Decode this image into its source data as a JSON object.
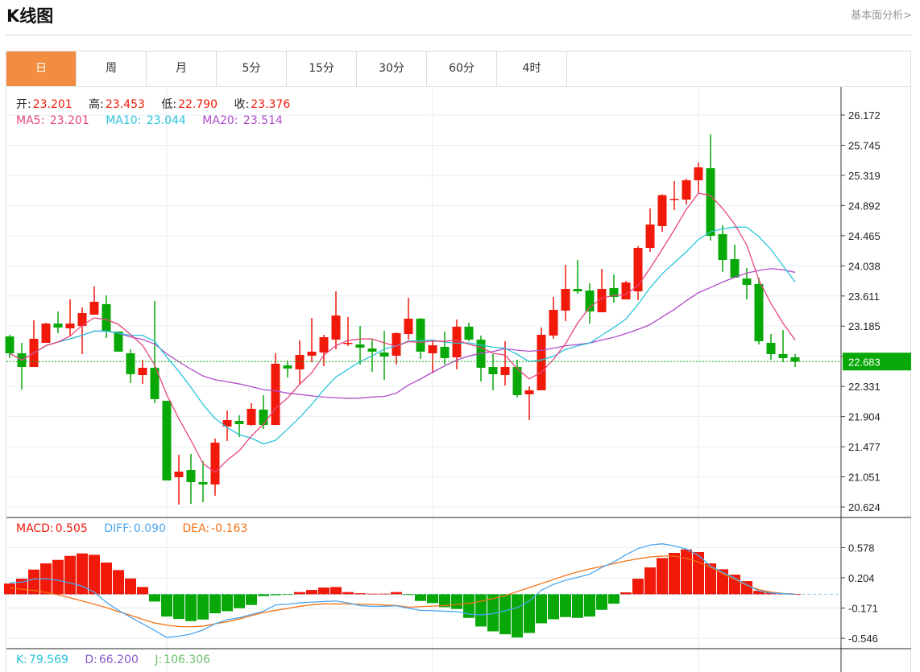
{
  "header": {
    "title": "K线图",
    "link": "基本面分析>"
  },
  "tabs": [
    {
      "label": "日",
      "active": true
    },
    {
      "label": "周"
    },
    {
      "label": "月"
    },
    {
      "label": "5分"
    },
    {
      "label": "15分"
    },
    {
      "label": "30分"
    },
    {
      "label": "60分"
    },
    {
      "label": "4时"
    }
  ],
  "ohlc": {
    "open_label": "开:",
    "open": "23.201",
    "high_label": "高:",
    "high": "23.453",
    "low_label": "低:",
    "low": "22.790",
    "close_label": "收:",
    "close": "23.376"
  },
  "ma": {
    "ma5_label": "MA5:",
    "ma5": "23.201",
    "ma10_label": "MA10:",
    "ma10": "23.044",
    "ma20_label": "MA20:",
    "ma20": "23.514"
  },
  "macd_info": {
    "macd_label": "MACD:",
    "macd": "0.505",
    "diff_label": "DIFF:",
    "diff": "0.090",
    "dea_label": "DEA:",
    "dea": "-0.163"
  },
  "kdj_info": {
    "k_label": "K:",
    "k": "79.569",
    "d_label": "D:",
    "d": "66.200",
    "j_label": "J:",
    "j": "106.306"
  },
  "colors": {
    "up": "#f0190a",
    "down": "#08a808",
    "ma5": "#e8467c",
    "ma10": "#2bc4dc",
    "ma20": "#b04cc8",
    "diff": "#4da6f0",
    "dea": "#f57314",
    "accent": "#f28c40"
  },
  "chart_data": {
    "type": "candlestick",
    "price_ticks": [
      "26.172",
      "25.745",
      "25.319",
      "24.892",
      "24.465",
      "24.038",
      "23.611",
      "23.185",
      "22.758",
      "22.331",
      "21.904",
      "21.477",
      "21.051",
      "20.624"
    ],
    "price_range": [
      20.624,
      26.172
    ],
    "last_price": "22.683",
    "candles_ohlc": [
      [
        23.039,
        23.062,
        22.732,
        22.8
      ],
      [
        22.8,
        22.948,
        22.287,
        22.606
      ],
      [
        22.606,
        23.267,
        22.606,
        23.005
      ],
      [
        22.948,
        23.233,
        22.948,
        23.221
      ],
      [
        23.221,
        23.392,
        23.085,
        23.165
      ],
      [
        23.153,
        23.563,
        23.039,
        23.221
      ],
      [
        23.187,
        23.449,
        22.789,
        23.37
      ],
      [
        23.347,
        23.746,
        23.347,
        23.529
      ],
      [
        23.495,
        23.62,
        23.016,
        23.108
      ],
      [
        23.108,
        23.108,
        22.823,
        22.823
      ],
      [
        22.8,
        22.857,
        22.379,
        22.504
      ],
      [
        22.492,
        22.709,
        22.367,
        22.595
      ],
      [
        22.595,
        23.54,
        22.094,
        22.151
      ],
      [
        22.128,
        22.128,
        21.0,
        21.0
      ],
      [
        21.046,
        21.365,
        20.658,
        21.125
      ],
      [
        21.148,
        21.376,
        20.669,
        20.977
      ],
      [
        20.977,
        21.274,
        20.692,
        20.943
      ],
      [
        20.943,
        21.592,
        20.784,
        21.535
      ],
      [
        21.763,
        21.991,
        21.558,
        21.854
      ],
      [
        21.843,
        21.923,
        21.615,
        21.797
      ],
      [
        21.786,
        22.094,
        21.775,
        22.014
      ],
      [
        22.003,
        22.208,
        21.729,
        21.786
      ],
      [
        21.786,
        22.8,
        21.786,
        22.652
      ],
      [
        22.629,
        22.697,
        22.458,
        22.584
      ],
      [
        22.572,
        22.982,
        22.356,
        22.777
      ],
      [
        22.766,
        23.301,
        22.675,
        22.823
      ],
      [
        22.811,
        23.062,
        22.618,
        23.028
      ],
      [
        22.994,
        23.677,
        22.857,
        23.335
      ],
      [
        22.937,
        23.313,
        22.903,
        22.948
      ],
      [
        22.925,
        23.187,
        22.641,
        22.88
      ],
      [
        22.868,
        22.994,
        22.538,
        22.823
      ],
      [
        22.811,
        23.119,
        22.424,
        22.754
      ],
      [
        22.766,
        23.096,
        22.641,
        23.085
      ],
      [
        23.073,
        23.586,
        22.994,
        23.29
      ],
      [
        23.29,
        23.301,
        22.72,
        22.823
      ],
      [
        22.8,
        22.982,
        22.515,
        22.914
      ],
      [
        22.891,
        23.108,
        22.641,
        22.732
      ],
      [
        22.743,
        23.278,
        22.572,
        23.176
      ],
      [
        23.176,
        23.233,
        22.971,
        22.994
      ],
      [
        22.994,
        23.051,
        22.401,
        22.595
      ],
      [
        22.606,
        22.789,
        22.276,
        22.504
      ],
      [
        22.492,
        22.971,
        22.344,
        22.606
      ],
      [
        22.606,
        22.709,
        22.173,
        22.208
      ],
      [
        22.219,
        22.333,
        21.854,
        22.276
      ],
      [
        22.276,
        23.165,
        22.276,
        23.062
      ],
      [
        23.051,
        23.597,
        23.005,
        23.415
      ],
      [
        23.404,
        24.053,
        23.256,
        23.711
      ],
      [
        23.711,
        24.121,
        23.643,
        23.677
      ],
      [
        23.689,
        23.791,
        23.221,
        23.392
      ],
      [
        23.381,
        23.996,
        23.381,
        23.711
      ],
      [
        23.723,
        23.916,
        23.518,
        23.597
      ],
      [
        23.563,
        23.825,
        23.563,
        23.802
      ],
      [
        23.677,
        24.315,
        23.552,
        24.292
      ],
      [
        24.292,
        24.851,
        24.235,
        24.623
      ],
      [
        24.6,
        25.05,
        24.52,
        25.039
      ],
      [
        24.976,
        25.238,
        24.828,
        24.987
      ],
      [
        24.976,
        25.272,
        24.907,
        25.249
      ],
      [
        25.249,
        25.5,
        25.067,
        25.432
      ],
      [
        25.42,
        25.899,
        24.395,
        24.463
      ],
      [
        24.486,
        24.611,
        23.951,
        24.121
      ],
      [
        24.133,
        24.338,
        23.871,
        23.871
      ],
      [
        23.859,
        24.007,
        23.563,
        23.768
      ],
      [
        23.78,
        23.871,
        22.925,
        22.971
      ],
      [
        22.948,
        23.073,
        22.709,
        22.789
      ],
      [
        22.789,
        23.13,
        22.675,
        22.732
      ],
      [
        22.743,
        22.789,
        22.606,
        22.683
      ]
    ],
    "macd_ticks": [
      "0.578",
      "0.204",
      "-0.171",
      "-0.546"
    ],
    "macd_hist": [
      0.133,
      0.193,
      0.306,
      0.383,
      0.426,
      0.476,
      0.506,
      0.489,
      0.393,
      0.3,
      0.196,
      0.09,
      -0.09,
      -0.276,
      -0.306,
      -0.333,
      -0.313,
      -0.236,
      -0.21,
      -0.173,
      -0.133,
      -0.023,
      -0.013,
      -0.007,
      0.027,
      0.053,
      0.083,
      0.09,
      0.027,
      0.013,
      0.007,
      0.007,
      0.027,
      -0.01,
      -0.083,
      -0.11,
      -0.16,
      -0.183,
      -0.293,
      -0.4,
      -0.46,
      -0.496,
      -0.536,
      -0.48,
      -0.36,
      -0.31,
      -0.283,
      -0.293,
      -0.276,
      -0.193,
      -0.117,
      0.023,
      0.193,
      0.333,
      0.449,
      0.513,
      0.556,
      0.523,
      0.383,
      0.31,
      0.243,
      0.163,
      0.043,
      0.02,
      0.007,
      0.002
    ],
    "diff": [
      0.143,
      0.15,
      0.19,
      0.193,
      0.173,
      0.14,
      0.1,
      0.027,
      -0.1,
      -0.2,
      -0.283,
      -0.366,
      -0.45,
      -0.536,
      -0.52,
      -0.493,
      -0.443,
      -0.366,
      -0.316,
      -0.29,
      -0.25,
      -0.21,
      -0.133,
      -0.123,
      -0.107,
      -0.097,
      -0.09,
      -0.083,
      -0.107,
      -0.14,
      -0.15,
      -0.15,
      -0.143,
      -0.173,
      -0.2,
      -0.203,
      -0.21,
      -0.216,
      -0.246,
      -0.256,
      -0.24,
      -0.206,
      -0.166,
      -0.083,
      0.05,
      0.123,
      0.173,
      0.21,
      0.25,
      0.333,
      0.4,
      0.49,
      0.566,
      0.61,
      0.626,
      0.6,
      0.56,
      0.483,
      0.35,
      0.273,
      0.2,
      0.117,
      0.04,
      0.017,
      0.007,
      0.0
    ],
    "dea": [
      0.077,
      0.063,
      0.047,
      0.023,
      -0.007,
      -0.043,
      -0.083,
      -0.123,
      -0.166,
      -0.216,
      -0.26,
      -0.31,
      -0.356,
      -0.383,
      -0.4,
      -0.403,
      -0.396,
      -0.366,
      -0.34,
      -0.306,
      -0.266,
      -0.226,
      -0.2,
      -0.176,
      -0.15,
      -0.13,
      -0.12,
      -0.12,
      -0.12,
      -0.123,
      -0.127,
      -0.133,
      -0.14,
      -0.16,
      -0.153,
      -0.147,
      -0.14,
      -0.127,
      -0.113,
      -0.087,
      -0.053,
      -0.017,
      0.033,
      0.083,
      0.133,
      0.183,
      0.233,
      0.276,
      0.313,
      0.346,
      0.38,
      0.413,
      0.44,
      0.463,
      0.473,
      0.473,
      0.446,
      0.4,
      0.333,
      0.256,
      0.183,
      0.11,
      0.057,
      0.027,
      0.01,
      0.003
    ]
  }
}
